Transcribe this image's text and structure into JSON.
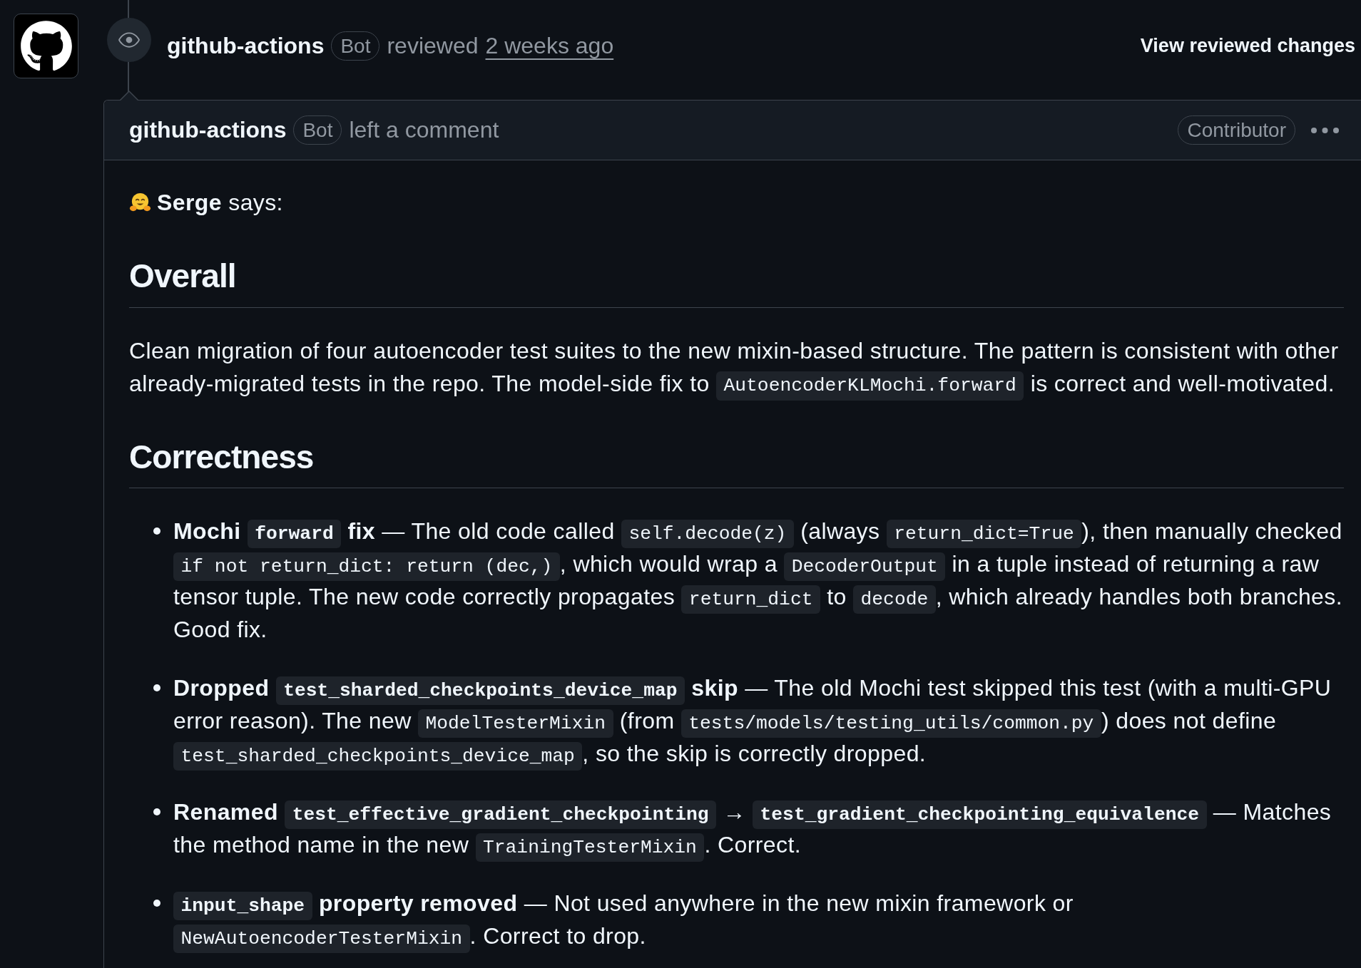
{
  "review": {
    "author": "github-actions",
    "author_badge": "Bot",
    "action": "reviewed",
    "time": "2 weeks ago",
    "view_changes_link": "View reviewed changes"
  },
  "comment": {
    "author": "github-actions",
    "author_badge": "Bot",
    "action": "left a comment",
    "role_badge": "Contributor",
    "body": [
      {
        "kind": "greeting",
        "text": "**Serge** says:"
      },
      {
        "kind": "heading",
        "text": "Overall"
      },
      {
        "kind": "paragraph",
        "segments": [
          {
            "kind": "text",
            "text": "Clean migration of four autoencoder test suites to the new mixin-based structure. The pattern is consistent with other already-migrated tests in the repo. The model-side fix to "
          },
          {
            "kind": "code",
            "text": "AutoencoderKLMochi.forward"
          },
          {
            "kind": "text",
            "text": " is correct and well-motivated."
          }
        ]
      },
      {
        "kind": "heading",
        "text": "Correctness"
      },
      {
        "kind": "list",
        "items": [
          {
            "lead": [
              {
                "kind": "text",
                "text": "Mochi "
              },
              {
                "kind": "code",
                "text": "forward"
              },
              {
                "kind": "text",
                "text": " fix"
              }
            ],
            "rest": [
              {
                "kind": "text",
                "text": " — The old code called "
              },
              {
                "kind": "code",
                "text": "self.decode(z)"
              },
              {
                "kind": "text",
                "text": " (always "
              },
              {
                "kind": "code",
                "text": "return_dict=True"
              },
              {
                "kind": "text",
                "text": "), then manually checked "
              },
              {
                "kind": "code",
                "text": "if not return_dict: return (dec,)"
              },
              {
                "kind": "text",
                "text": ", which would wrap a "
              },
              {
                "kind": "code",
                "text": "DecoderOutput"
              },
              {
                "kind": "text",
                "text": " in a tuple instead of returning a raw tensor tuple. The new code correctly propagates "
              },
              {
                "kind": "code",
                "text": "return_dict"
              },
              {
                "kind": "text",
                "text": " to "
              },
              {
                "kind": "code",
                "text": "decode"
              },
              {
                "kind": "text",
                "text": ", which already handles both branches. Good fix."
              }
            ]
          },
          {
            "lead": [
              {
                "kind": "text",
                "text": "Dropped "
              },
              {
                "kind": "code",
                "text": "test_sharded_checkpoints_device_map"
              },
              {
                "kind": "text",
                "text": " skip"
              }
            ],
            "rest": [
              {
                "kind": "text",
                "text": " — The old Mochi test skipped this test (with a multi-GPU error reason). The new "
              },
              {
                "kind": "code",
                "text": "ModelTesterMixin"
              },
              {
                "kind": "text",
                "text": " (from "
              },
              {
                "kind": "code",
                "text": "tests/models/testing_utils/common.py"
              },
              {
                "kind": "text",
                "text": ") does not define "
              },
              {
                "kind": "code",
                "text": "test_sharded_checkpoints_device_map"
              },
              {
                "kind": "text",
                "text": ", so the skip is correctly dropped."
              }
            ]
          },
          {
            "lead": [
              {
                "kind": "text",
                "text": "Renamed "
              },
              {
                "kind": "code",
                "text": "test_effective_gradient_checkpointing"
              },
              {
                "kind": "text",
                "text": " → "
              },
              {
                "kind": "code",
                "text": "test_gradient_checkpointing_equivalence"
              }
            ],
            "rest": [
              {
                "kind": "text",
                "text": " — Matches the method name in the new "
              },
              {
                "kind": "code",
                "text": "TrainingTesterMixin"
              },
              {
                "kind": "text",
                "text": ". Correct."
              }
            ]
          },
          {
            "lead": [
              {
                "kind": "code",
                "text": "input_shape"
              },
              {
                "kind": "text",
                "text": " property removed"
              }
            ],
            "rest": [
              {
                "kind": "text",
                "text": " — Not used anywhere in the new mixin framework or "
              },
              {
                "kind": "code",
                "text": "NewAutoencoderTesterMixin"
              },
              {
                "kind": "text",
                "text": ". Correct to drop."
              }
            ]
          }
        ]
      }
    ]
  }
}
